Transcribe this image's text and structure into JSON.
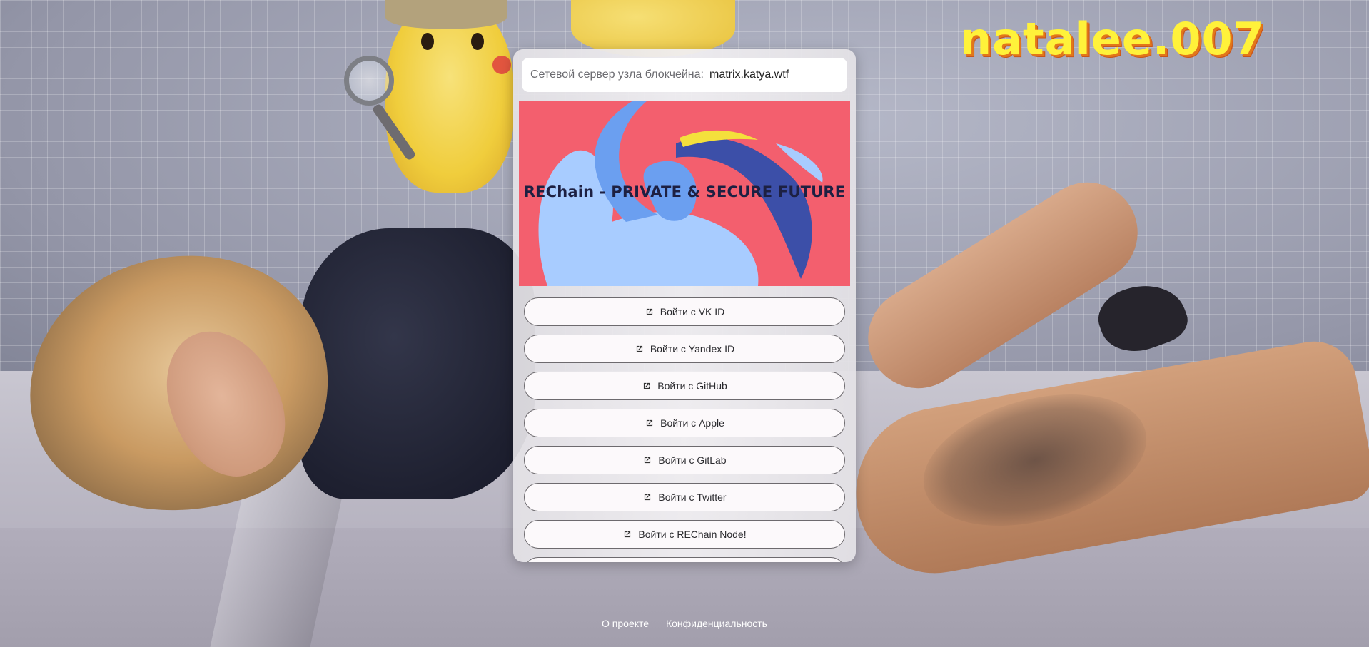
{
  "brand": {
    "text": "natalee.007"
  },
  "homeserver": {
    "label": "Сетевой сервер узла блокчейна:",
    "value": "matrix.katya.wtf",
    "search_icon": "search-icon"
  },
  "banner": {
    "title": "REChain - PRIVATE & SECURE FUTURE",
    "colors": {
      "bg": "#f35f6e",
      "light_blue": "#a8ccff",
      "mid_blue": "#6b9ff0",
      "dark_blue": "#3c4fa8",
      "yellow": "#f4e03c"
    }
  },
  "login_buttons": [
    {
      "label": "Войти с VK ID",
      "icon": "external-link-icon"
    },
    {
      "label": "Войти с Yandex ID",
      "icon": "external-link-icon"
    },
    {
      "label": "Войти с GitHub",
      "icon": "external-link-icon"
    },
    {
      "label": "Войти с Apple",
      "icon": "external-link-icon"
    },
    {
      "label": "Войти с GitLab",
      "icon": "external-link-icon"
    },
    {
      "label": "Войти с Twitter",
      "icon": "external-link-icon"
    },
    {
      "label": "Войти с REChain Node!",
      "icon": "external-link-icon"
    }
  ],
  "footer": {
    "about": "О проекте",
    "privacy": "Конфиденциальность"
  }
}
